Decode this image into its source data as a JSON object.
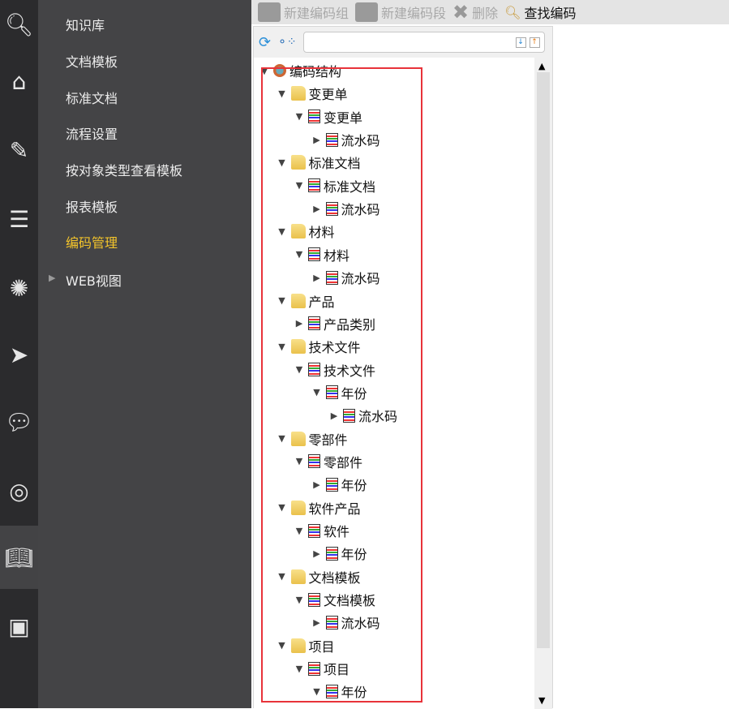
{
  "rail": [
    "sipm-search-icon",
    "home-icon",
    "edit-icon",
    "database-icon",
    "loading-icon",
    "send-icon",
    "chat-icon",
    "podcast-icon",
    "book-icon",
    "id-card-icon"
  ],
  "nav": {
    "items": [
      "知识库",
      "文档模板",
      "标准文档",
      "流程设置",
      "按对象类型查看模板",
      "报表模板",
      "编码管理",
      "WEB视图"
    ],
    "selected": "编码管理"
  },
  "toolbar": {
    "new_group": "新建编码组",
    "new_segment": "新建编码段",
    "delete": "删除",
    "find": "查找编码"
  },
  "search": {
    "value": "",
    "down": "↓",
    "up": "↑"
  },
  "tree": [
    {
      "l": 0,
      "t": "root",
      "e": "open",
      "label": "编码结构"
    },
    {
      "l": 1,
      "t": "folder",
      "e": "open",
      "label": "变更单"
    },
    {
      "l": 2,
      "t": "doc",
      "e": "open",
      "label": "变更单"
    },
    {
      "l": 3,
      "t": "doc",
      "e": "closed",
      "label": "流水码"
    },
    {
      "l": 1,
      "t": "folder",
      "e": "open",
      "label": "标准文档"
    },
    {
      "l": 2,
      "t": "doc",
      "e": "open",
      "label": "标准文档"
    },
    {
      "l": 3,
      "t": "doc",
      "e": "closed",
      "label": "流水码"
    },
    {
      "l": 1,
      "t": "folder",
      "e": "open",
      "label": "材料"
    },
    {
      "l": 2,
      "t": "doc",
      "e": "open",
      "label": "材料"
    },
    {
      "l": 3,
      "t": "doc",
      "e": "closed",
      "label": "流水码"
    },
    {
      "l": 1,
      "t": "folder",
      "e": "open",
      "label": "产品"
    },
    {
      "l": 2,
      "t": "doc",
      "e": "closed",
      "label": "产品类别"
    },
    {
      "l": 1,
      "t": "folder",
      "e": "open",
      "label": "技术文件"
    },
    {
      "l": 2,
      "t": "doc",
      "e": "open",
      "label": "技术文件"
    },
    {
      "l": 3,
      "t": "doc",
      "e": "open",
      "label": "年份"
    },
    {
      "l": 4,
      "t": "doc",
      "e": "closed",
      "label": "流水码"
    },
    {
      "l": 1,
      "t": "folder",
      "e": "open",
      "label": "零部件"
    },
    {
      "l": 2,
      "t": "doc",
      "e": "open",
      "label": "零部件"
    },
    {
      "l": 3,
      "t": "doc",
      "e": "closed",
      "label": "年份"
    },
    {
      "l": 1,
      "t": "folder",
      "e": "open",
      "label": "软件产品"
    },
    {
      "l": 2,
      "t": "doc",
      "e": "open",
      "label": "软件"
    },
    {
      "l": 3,
      "t": "doc",
      "e": "closed",
      "label": "年份"
    },
    {
      "l": 1,
      "t": "folder",
      "e": "open",
      "label": "文档模板"
    },
    {
      "l": 2,
      "t": "doc",
      "e": "open",
      "label": "文档模板"
    },
    {
      "l": 3,
      "t": "doc",
      "e": "closed",
      "label": "流水码"
    },
    {
      "l": 1,
      "t": "folder",
      "e": "open",
      "label": "项目"
    },
    {
      "l": 2,
      "t": "doc",
      "e": "open",
      "label": "项目"
    },
    {
      "l": 3,
      "t": "doc",
      "e": "open",
      "label": "年份"
    }
  ],
  "colors": {
    "selected_nav": "#f3c42b",
    "highlight_box": "#e8333a"
  }
}
